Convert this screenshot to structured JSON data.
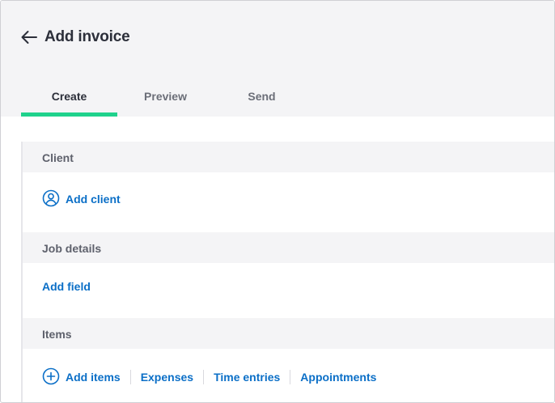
{
  "header": {
    "title": "Add invoice"
  },
  "tabs": [
    {
      "label": "Create",
      "active": true
    },
    {
      "label": "Preview",
      "active": false
    },
    {
      "label": "Send",
      "active": false
    }
  ],
  "sections": {
    "client": {
      "title": "Client",
      "action_label": "Add client"
    },
    "job_details": {
      "title": "Job details",
      "action_label": "Add field"
    },
    "items": {
      "title": "Items",
      "actions": [
        "Add items",
        "Expenses",
        "Time entries",
        "Appointments"
      ]
    }
  },
  "icons": {
    "back": "arrow-left-icon",
    "client": "user-circle-icon",
    "add_items": "plus-circle-icon"
  },
  "colors": {
    "accent": "#1fd28c",
    "link": "#0b6fc7",
    "text_primary": "#2c2f3a",
    "text_muted": "#6b6e78",
    "section_bg": "#f4f4f6"
  }
}
